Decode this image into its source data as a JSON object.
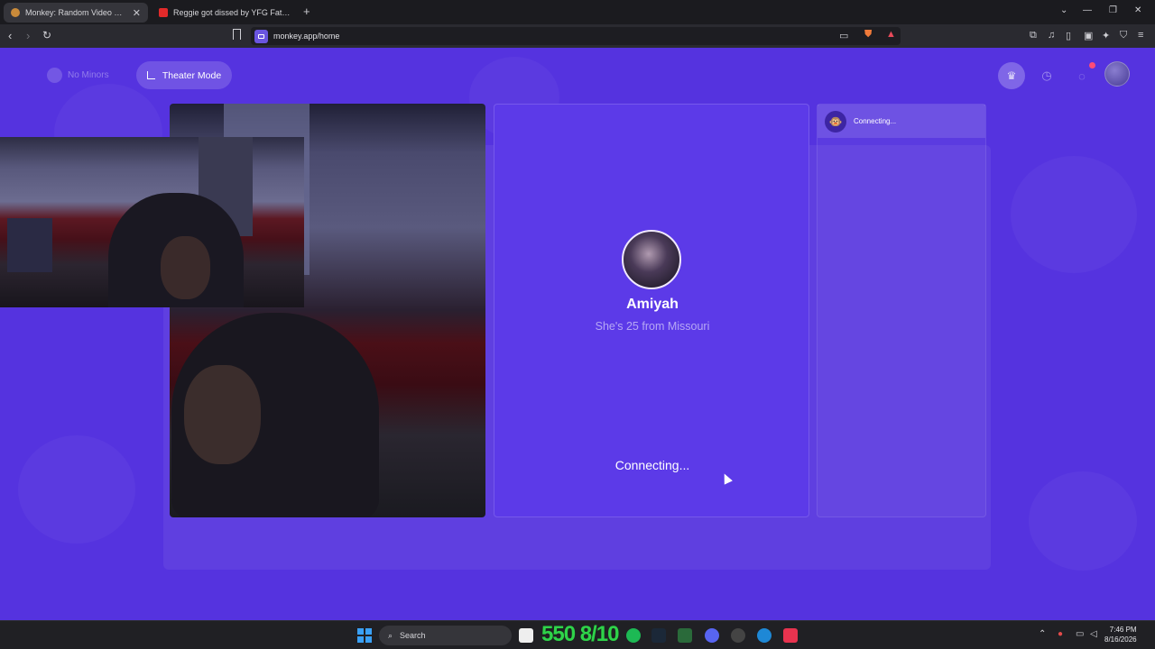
{
  "browser": {
    "tabs": [
      {
        "title": "Monkey: Random Video Chat",
        "active": true
      },
      {
        "title": "Reggie got dissed by YFG Fatso 😂😂",
        "active": false
      }
    ],
    "new_tab": "+",
    "address": "monkey.app/home"
  },
  "header": {
    "no_minors_label": "No Minors",
    "theater_mode_label": "Theater Mode",
    "notification_count": "2"
  },
  "stranger": {
    "name": "Amiyah",
    "description": "She's 25 from Missouri",
    "status": "Connecting..."
  },
  "chat_panel": {
    "status": "Connecting..."
  },
  "taskbar": {
    "search_placeholder": "Search",
    "overlay_text": "550 8/10",
    "time": "7:46 PM",
    "date": "8/16/2026"
  },
  "colors": {
    "page_background": "#5533df",
    "panel_background": "#5c3ae8",
    "accent_green": "#2fd34a"
  }
}
